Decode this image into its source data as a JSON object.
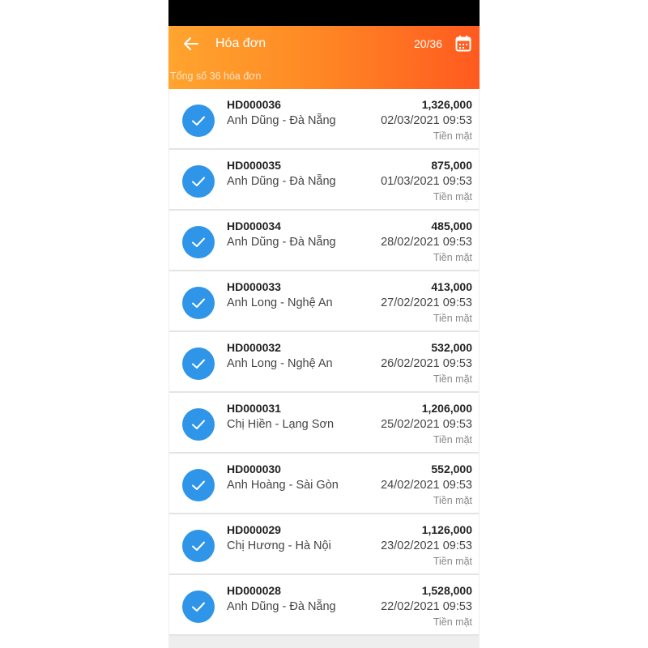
{
  "header": {
    "title": "Hóa đơn",
    "counter": "20/36",
    "summary": "Tổng số 36 hóa đơn"
  },
  "colors": {
    "accent_start": "#ffa42e",
    "accent_end": "#ff5a1f",
    "check_blue": "#2f95e9"
  },
  "icons": {
    "back": "arrow-left",
    "calendar": "calendar",
    "check": "checkmark"
  },
  "invoices": [
    {
      "code": "HD000036",
      "customer": "Anh Dũng - Đà Nẵng",
      "amount": "1,326,000",
      "datetime": "02/03/2021 09:53",
      "payment": "Tiền mặt"
    },
    {
      "code": "HD000035",
      "customer": "Anh Dũng - Đà Nẵng",
      "amount": "875,000",
      "datetime": "01/03/2021 09:53",
      "payment": "Tiền mặt"
    },
    {
      "code": "HD000034",
      "customer": "Anh Dũng - Đà Nẵng",
      "amount": "485,000",
      "datetime": "28/02/2021 09:53",
      "payment": "Tiền mặt"
    },
    {
      "code": "HD000033",
      "customer": "Anh Long - Nghệ An",
      "amount": "413,000",
      "datetime": "27/02/2021 09:53",
      "payment": "Tiền mặt"
    },
    {
      "code": "HD000032",
      "customer": "Anh Long - Nghệ An",
      "amount": "532,000",
      "datetime": "26/02/2021 09:53",
      "payment": "Tiền mặt"
    },
    {
      "code": "HD000031",
      "customer": "Chị Hiền - Lạng Sơn",
      "amount": "1,206,000",
      "datetime": "25/02/2021 09:53",
      "payment": "Tiền mặt"
    },
    {
      "code": "HD000030",
      "customer": "Anh Hoàng - Sài Gòn",
      "amount": "552,000",
      "datetime": "24/02/2021 09:53",
      "payment": "Tiền mặt"
    },
    {
      "code": "HD000029",
      "customer": "Chị Hương - Hà Nội",
      "amount": "1,126,000",
      "datetime": "23/02/2021 09:53",
      "payment": "Tiền mặt"
    },
    {
      "code": "HD000028",
      "customer": "Anh Dũng - Đà Nẵng",
      "amount": "1,528,000",
      "datetime": "22/02/2021 09:53",
      "payment": "Tiền mặt"
    }
  ]
}
